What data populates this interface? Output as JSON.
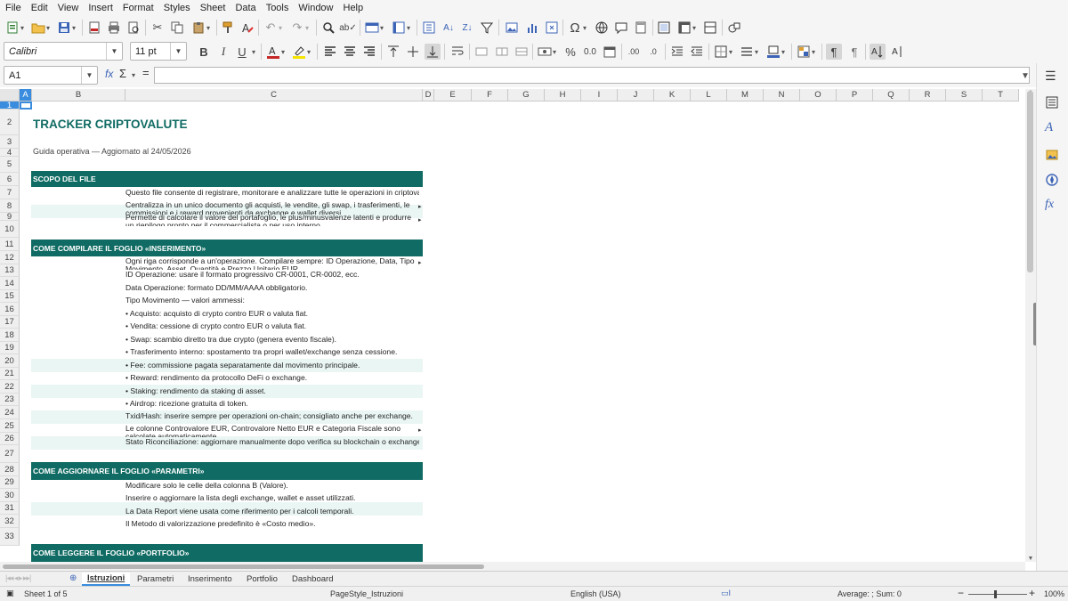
{
  "menu": [
    "File",
    "Edit",
    "View",
    "Insert",
    "Format",
    "Styles",
    "Sheet",
    "Data",
    "Tools",
    "Window",
    "Help"
  ],
  "toolbar": {
    "font_name": "Calibri",
    "font_size": "11 pt",
    "bold": "B",
    "italic": "I",
    "underline": "U",
    "percent": "%",
    "number_format": "0.0",
    "add_decimal": ".00",
    "remove_decimal": ".0"
  },
  "formula_bar": {
    "cell_ref": "A1",
    "function_label": "fx",
    "sum_label": "Σ",
    "equals_label": "=",
    "content": ""
  },
  "columns": [
    {
      "label": "A",
      "selected": true
    },
    {
      "label": "B"
    },
    {
      "label": "C"
    },
    {
      "label": "D"
    },
    {
      "label": "E"
    },
    {
      "label": "F"
    },
    {
      "label": "G"
    },
    {
      "label": "H"
    },
    {
      "label": "I"
    },
    {
      "label": "J"
    },
    {
      "label": "K"
    },
    {
      "label": "L"
    },
    {
      "label": "M"
    },
    {
      "label": "N"
    },
    {
      "label": "O"
    },
    {
      "label": "P"
    },
    {
      "label": "Q"
    },
    {
      "label": "R"
    },
    {
      "label": "S"
    },
    {
      "label": "T"
    }
  ],
  "rows": [
    "1",
    "2",
    "3",
    "4",
    "5",
    "6",
    "7",
    "8",
    "9",
    "10",
    "11",
    "12",
    "13",
    "14",
    "15",
    "16",
    "17",
    "18",
    "19",
    "20",
    "21",
    "22",
    "23",
    "24",
    "25",
    "26",
    "27",
    "28",
    "29",
    "30",
    "31",
    "32",
    "33"
  ],
  "sheet": {
    "title": "TRACKER CRIPTOVALUTE",
    "subtitle": "Guida operativa — Aggiornato al 24/05/2026",
    "sections": [
      {
        "row": "5",
        "label": "SCOPO DEL FILE"
      },
      {
        "row": "10",
        "label": "COME COMPILARE IL FOGLIO «INSERIMENTO»"
      },
      {
        "row": "27",
        "label": "COME AGGIORNARE IL FOGLIO «PARAMETRI»"
      },
      {
        "row": "33",
        "label": "COME LEGGERE IL FOGLIO «PORTFOLIO»"
      }
    ],
    "lines": [
      {
        "row": "6",
        "text": "Questo file consente di registrare, monitorare e analizzare tutte le operazioni in criptovalute."
      },
      {
        "row": "7",
        "text": "Centralizza in un unico documento gli acquisti, le vendite, gli swap, i trasferimenti, le commissioni e i reward provenienti da exchange e wallet diversi."
      },
      {
        "row": "8",
        "text": "Permette di calcolare il valore del portafoglio, le plus/minusvalenze latenti e produrre un riepilogo pronto per il commercialista o per uso interno."
      },
      {
        "row": "11",
        "text": "Ogni riga corrisponde a un'operazione. Compilare sempre: ID Operazione, Data, Tipo Movimento, Asset, Quantità e Prezzo Unitario EUR."
      },
      {
        "row": "12",
        "text": "ID Operazione: usare il formato progressivo CR-0001, CR-0002, ecc."
      },
      {
        "row": "13",
        "text": "Data Operazione: formato DD/MM/AAAA obbligatorio."
      },
      {
        "row": "14",
        "text": "Tipo Movimento — valori ammessi:"
      },
      {
        "row": "15",
        "text": "  • Acquisto: acquisto di crypto contro EUR o valuta fiat."
      },
      {
        "row": "16",
        "text": "  • Vendita: cessione di crypto contro EUR o valuta fiat."
      },
      {
        "row": "17",
        "text": "  • Swap: scambio diretto tra due crypto (genera evento fiscale)."
      },
      {
        "row": "18",
        "text": "  • Trasferimento interno: spostamento tra propri wallet/exchange senza cessione."
      },
      {
        "row": "19",
        "text": "  • Fee: commissione pagata separatamente dal movimento principale."
      },
      {
        "row": "20",
        "text": "  • Reward: rendimento da protocollo DeFi o exchange."
      },
      {
        "row": "21",
        "text": "  • Staking: rendimento da staking di asset."
      },
      {
        "row": "22",
        "text": "  • Airdrop: ricezione gratuita di token."
      },
      {
        "row": "23",
        "text": "Txid/Hash: inserire sempre per operazioni on-chain; consigliato anche per exchange."
      },
      {
        "row": "24",
        "text": "Le colonne Controvalore EUR, Controvalore Netto EUR e Categoria Fiscale sono calcolate automaticamente."
      },
      {
        "row": "25",
        "text": "Stato Riconciliazione: aggiornare manualmente dopo verifica su blockchain o exchange."
      },
      {
        "row": "28",
        "text": "Modificare solo le celle della colonna B (Valore)."
      },
      {
        "row": "29",
        "text": "Inserire o aggiornare la lista degli exchange, wallet e asset utilizzati."
      },
      {
        "row": "30",
        "text": "La Data Report viene usata come riferimento per i calcoli temporali."
      },
      {
        "row": "31",
        "text": "Il Metodo di valorizzazione predefinito è «Costo medio»."
      }
    ]
  },
  "tabs": [
    "Istruzioni",
    "Parametri",
    "Inserimento",
    "Portfolio",
    "Dashboard"
  ],
  "status": {
    "sheet": "Sheet 1 of 5",
    "page_style": "PageStyle_Istruzioni",
    "language": "English (USA)",
    "summary": "Average: ; Sum: 0",
    "zoom": "100%"
  },
  "colors": {
    "section_band": "#0f6b63",
    "title": "#0f6b63",
    "stripe": "#eaf6f4",
    "selection": "#3a8dde"
  }
}
